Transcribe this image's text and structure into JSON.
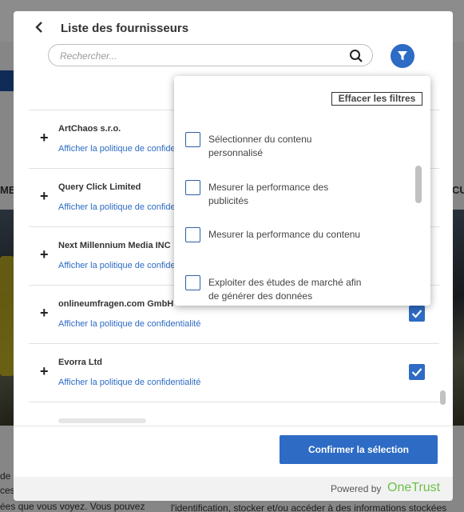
{
  "background": {
    "nav_left": "ME",
    "nav_right": "CU",
    "bottom_left_1": "de",
    "bottom_left_2": "ces",
    "bottom_left_3": "ées que vous voyez. Vous pouvez",
    "bottom_right": "l'identification, stocker et/ou accéder à des informations stockées"
  },
  "header": {
    "back_icon": "chevron-left-icon",
    "title": "Liste des fournisseurs",
    "search_placeholder": "Rechercher...",
    "search_icon": "search-icon",
    "filter_icon": "filter-icon"
  },
  "vendors": [
    {
      "name": "ArtChaos s.r.o.",
      "link": "Afficher la politique de confidentialité",
      "checked": false
    },
    {
      "name": "Query Click Limited",
      "link": "Afficher la politique de confidentialité",
      "checked": false
    },
    {
      "name": "Next Millennium Media INC",
      "link": "Afficher la politique de confidentialité",
      "checked": false
    },
    {
      "name": "onlineumfragen.com GmbH",
      "link": "Afficher la politique de confidentialité",
      "checked": true
    },
    {
      "name": "Evorra Ltd",
      "link": "Afficher la politique de confidentialité",
      "checked": true
    }
  ],
  "filter": {
    "clear_label": "Effacer les filtres",
    "options": [
      "Sélectionner du contenu personnalisé",
      "Mesurer la performance des publicités",
      "Mesurer la performance du contenu",
      "Exploiter des études de marché afin de générer des données"
    ]
  },
  "footer": {
    "confirm_label": "Confirmer la sélection",
    "powered_by": "Powered by",
    "brand": "OneTrust"
  },
  "colors": {
    "accent": "#2d6bc4",
    "brand_green": "#6cc04a"
  }
}
